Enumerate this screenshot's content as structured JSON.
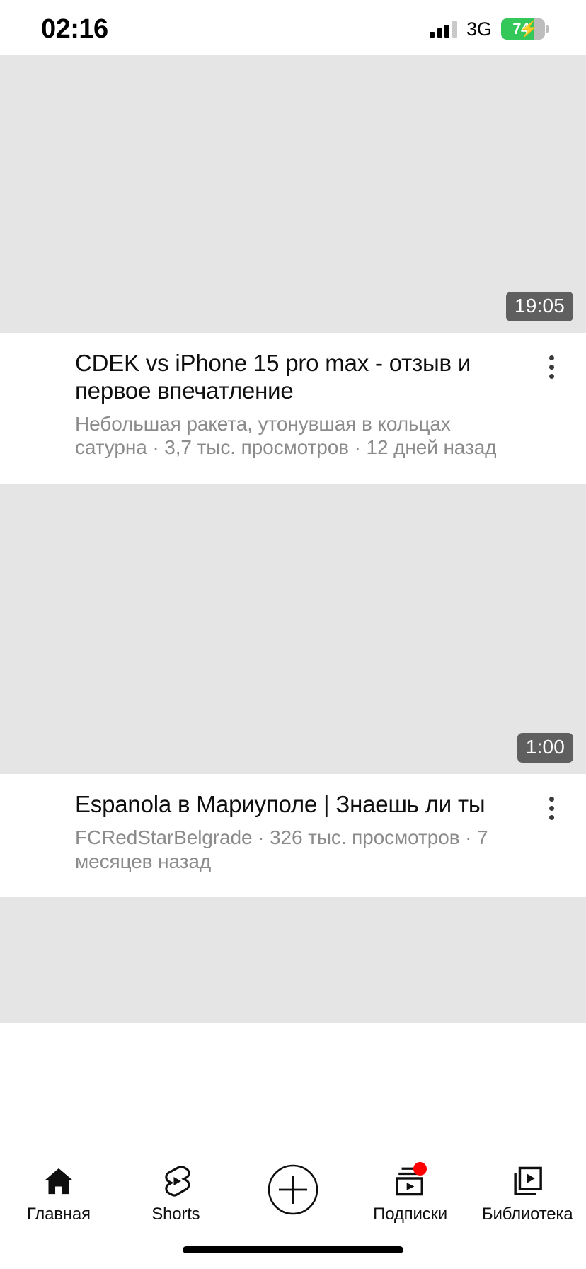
{
  "status_bar": {
    "time": "02:16",
    "network_type": "3G",
    "battery_percent": "74",
    "battery_charging_icon": "lightning-bolt",
    "battery_color": "#34C759",
    "signal_bars_total": 4,
    "signal_bars_active": 3
  },
  "feed": {
    "videos": [
      {
        "title": "CDEK vs iPhone 15 pro max - отзыв и первое впечатление",
        "meta": "Небольшая ракета, утонувшая в кольцах сатурна · 3,7 тыс. просмотров · 12 дней назад",
        "channel": "Небольшая ракета, утонувшая в кольцах сатурна",
        "views": "3,7 тыс. просмотров",
        "published": "12 дней назад",
        "duration": "19:05",
        "menu_icon": "kebab-menu-icon"
      },
      {
        "title": "Espanola в Мариуполе | Знаешь ли ты",
        "meta": "FCRedStarBelgrade · 326 тыс. просмотров · 7 месяцев назад",
        "channel": "FCRedStarBelgrade",
        "views": "326 тыс. просмотров",
        "published": "7 месяцев назад",
        "duration": "1:00",
        "menu_icon": "kebab-menu-icon"
      },
      {
        "title": "",
        "meta": "",
        "duration": "",
        "menu_icon": "kebab-menu-icon"
      }
    ]
  },
  "bottom_nav": {
    "items": [
      {
        "label": "Главная",
        "icon": "home-icon",
        "active": true,
        "badge": false
      },
      {
        "label": "Shorts",
        "icon": "shorts-icon",
        "active": false,
        "badge": false
      },
      {
        "label": "",
        "icon": "create-plus-icon",
        "active": false,
        "badge": false
      },
      {
        "label": "Подписки",
        "icon": "subscriptions-icon",
        "active": false,
        "badge": true
      },
      {
        "label": "Библиотека",
        "icon": "library-icon",
        "active": false,
        "badge": false
      }
    ],
    "badge_color": "#ff0000"
  }
}
